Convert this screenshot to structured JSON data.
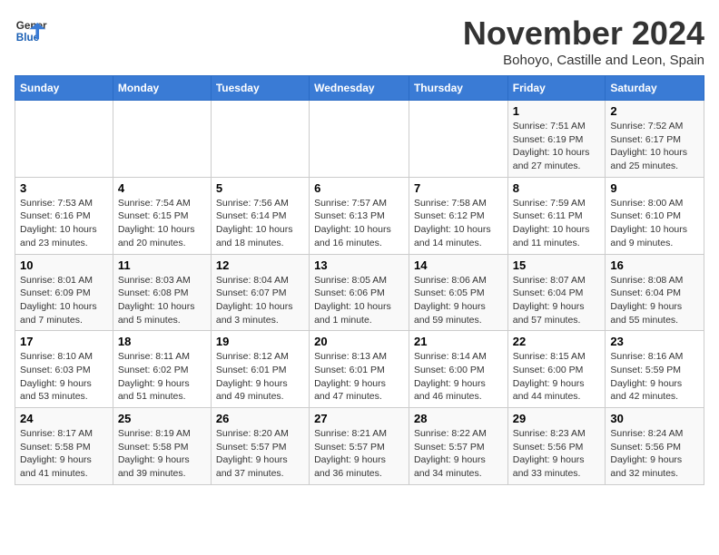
{
  "logo": {
    "line1": "General",
    "line2": "Blue"
  },
  "title": "November 2024",
  "subtitle": "Bohoyo, Castille and Leon, Spain",
  "weekdays": [
    "Sunday",
    "Monday",
    "Tuesday",
    "Wednesday",
    "Thursday",
    "Friday",
    "Saturday"
  ],
  "weeks": [
    [
      {
        "day": "",
        "info": ""
      },
      {
        "day": "",
        "info": ""
      },
      {
        "day": "",
        "info": ""
      },
      {
        "day": "",
        "info": ""
      },
      {
        "day": "",
        "info": ""
      },
      {
        "day": "1",
        "info": "Sunrise: 7:51 AM\nSunset: 6:19 PM\nDaylight: 10 hours and 27 minutes."
      },
      {
        "day": "2",
        "info": "Sunrise: 7:52 AM\nSunset: 6:17 PM\nDaylight: 10 hours and 25 minutes."
      }
    ],
    [
      {
        "day": "3",
        "info": "Sunrise: 7:53 AM\nSunset: 6:16 PM\nDaylight: 10 hours and 23 minutes."
      },
      {
        "day": "4",
        "info": "Sunrise: 7:54 AM\nSunset: 6:15 PM\nDaylight: 10 hours and 20 minutes."
      },
      {
        "day": "5",
        "info": "Sunrise: 7:56 AM\nSunset: 6:14 PM\nDaylight: 10 hours and 18 minutes."
      },
      {
        "day": "6",
        "info": "Sunrise: 7:57 AM\nSunset: 6:13 PM\nDaylight: 10 hours and 16 minutes."
      },
      {
        "day": "7",
        "info": "Sunrise: 7:58 AM\nSunset: 6:12 PM\nDaylight: 10 hours and 14 minutes."
      },
      {
        "day": "8",
        "info": "Sunrise: 7:59 AM\nSunset: 6:11 PM\nDaylight: 10 hours and 11 minutes."
      },
      {
        "day": "9",
        "info": "Sunrise: 8:00 AM\nSunset: 6:10 PM\nDaylight: 10 hours and 9 minutes."
      }
    ],
    [
      {
        "day": "10",
        "info": "Sunrise: 8:01 AM\nSunset: 6:09 PM\nDaylight: 10 hours and 7 minutes."
      },
      {
        "day": "11",
        "info": "Sunrise: 8:03 AM\nSunset: 6:08 PM\nDaylight: 10 hours and 5 minutes."
      },
      {
        "day": "12",
        "info": "Sunrise: 8:04 AM\nSunset: 6:07 PM\nDaylight: 10 hours and 3 minutes."
      },
      {
        "day": "13",
        "info": "Sunrise: 8:05 AM\nSunset: 6:06 PM\nDaylight: 10 hours and 1 minute."
      },
      {
        "day": "14",
        "info": "Sunrise: 8:06 AM\nSunset: 6:05 PM\nDaylight: 9 hours and 59 minutes."
      },
      {
        "day": "15",
        "info": "Sunrise: 8:07 AM\nSunset: 6:04 PM\nDaylight: 9 hours and 57 minutes."
      },
      {
        "day": "16",
        "info": "Sunrise: 8:08 AM\nSunset: 6:04 PM\nDaylight: 9 hours and 55 minutes."
      }
    ],
    [
      {
        "day": "17",
        "info": "Sunrise: 8:10 AM\nSunset: 6:03 PM\nDaylight: 9 hours and 53 minutes."
      },
      {
        "day": "18",
        "info": "Sunrise: 8:11 AM\nSunset: 6:02 PM\nDaylight: 9 hours and 51 minutes."
      },
      {
        "day": "19",
        "info": "Sunrise: 8:12 AM\nSunset: 6:01 PM\nDaylight: 9 hours and 49 minutes."
      },
      {
        "day": "20",
        "info": "Sunrise: 8:13 AM\nSunset: 6:01 PM\nDaylight: 9 hours and 47 minutes."
      },
      {
        "day": "21",
        "info": "Sunrise: 8:14 AM\nSunset: 6:00 PM\nDaylight: 9 hours and 46 minutes."
      },
      {
        "day": "22",
        "info": "Sunrise: 8:15 AM\nSunset: 6:00 PM\nDaylight: 9 hours and 44 minutes."
      },
      {
        "day": "23",
        "info": "Sunrise: 8:16 AM\nSunset: 5:59 PM\nDaylight: 9 hours and 42 minutes."
      }
    ],
    [
      {
        "day": "24",
        "info": "Sunrise: 8:17 AM\nSunset: 5:58 PM\nDaylight: 9 hours and 41 minutes."
      },
      {
        "day": "25",
        "info": "Sunrise: 8:19 AM\nSunset: 5:58 PM\nDaylight: 9 hours and 39 minutes."
      },
      {
        "day": "26",
        "info": "Sunrise: 8:20 AM\nSunset: 5:57 PM\nDaylight: 9 hours and 37 minutes."
      },
      {
        "day": "27",
        "info": "Sunrise: 8:21 AM\nSunset: 5:57 PM\nDaylight: 9 hours and 36 minutes."
      },
      {
        "day": "28",
        "info": "Sunrise: 8:22 AM\nSunset: 5:57 PM\nDaylight: 9 hours and 34 minutes."
      },
      {
        "day": "29",
        "info": "Sunrise: 8:23 AM\nSunset: 5:56 PM\nDaylight: 9 hours and 33 minutes."
      },
      {
        "day": "30",
        "info": "Sunrise: 8:24 AM\nSunset: 5:56 PM\nDaylight: 9 hours and 32 minutes."
      }
    ]
  ]
}
